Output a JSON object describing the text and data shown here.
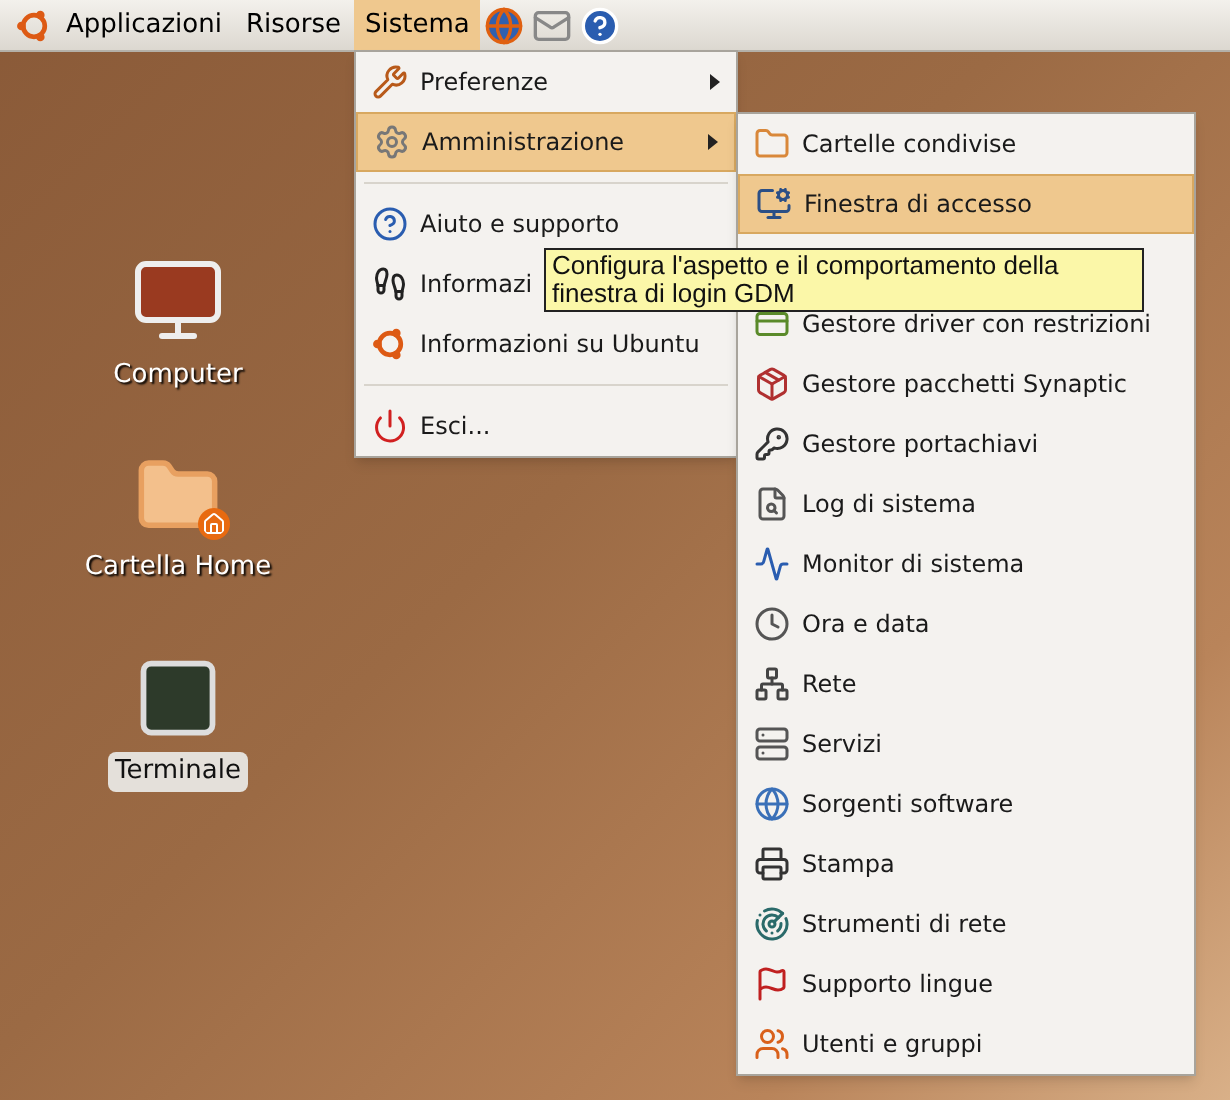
{
  "panel": {
    "menus": [
      {
        "label": "Applicazioni",
        "selected": false
      },
      {
        "label": "Risorse",
        "selected": false
      },
      {
        "label": "Sistema",
        "selected": true
      }
    ]
  },
  "desktop_icons": [
    {
      "kind": "computer",
      "label": "Computer",
      "selected": false
    },
    {
      "kind": "home",
      "label": "Cartella Home",
      "selected": false
    },
    {
      "kind": "terminal",
      "label": "Terminale",
      "selected": true
    }
  ],
  "system_menu": {
    "items": [
      {
        "kind": "item",
        "label": "Preferenze",
        "submenu": true,
        "selected": false
      },
      {
        "kind": "item",
        "label": "Amministrazione",
        "submenu": true,
        "selected": true
      },
      {
        "kind": "separator"
      },
      {
        "kind": "item",
        "label": "Aiuto e supporto",
        "submenu": false,
        "selected": false
      },
      {
        "kind": "item",
        "label": "Informazi",
        "submenu": false,
        "selected": false
      },
      {
        "kind": "item",
        "label": "Informazioni su Ubuntu",
        "submenu": false,
        "selected": false
      },
      {
        "kind": "separator"
      },
      {
        "kind": "item",
        "label": "Esci...",
        "submenu": false,
        "selected": false
      }
    ]
  },
  "admin_menu": {
    "items": [
      {
        "kind": "item",
        "label": "Cartelle condivise",
        "selected": false
      },
      {
        "kind": "item",
        "label": "Finestra di accesso",
        "selected": true
      },
      {
        "kind": "covered"
      },
      {
        "kind": "item",
        "label": "Gestore driver con restrizioni",
        "selected": false
      },
      {
        "kind": "item",
        "label": "Gestore pacchetti Synaptic",
        "selected": false
      },
      {
        "kind": "item",
        "label": "Gestore portachiavi",
        "selected": false
      },
      {
        "kind": "item",
        "label": "Log di sistema",
        "selected": false
      },
      {
        "kind": "item",
        "label": "Monitor di sistema",
        "selected": false
      },
      {
        "kind": "item",
        "label": "Ora e data",
        "selected": false
      },
      {
        "kind": "item",
        "label": "Rete",
        "selected": false
      },
      {
        "kind": "item",
        "label": "Servizi",
        "selected": false
      },
      {
        "kind": "item",
        "label": "Sorgenti software",
        "selected": false
      },
      {
        "kind": "item",
        "label": "Stampa",
        "selected": false
      },
      {
        "kind": "item",
        "label": "Strumenti di rete",
        "selected": false
      },
      {
        "kind": "item",
        "label": "Supporto lingue",
        "selected": false
      },
      {
        "kind": "item",
        "label": "Utenti e gruppi",
        "selected": false
      }
    ]
  },
  "tooltip": {
    "text": "Configura l'aspetto e il comportamento della finestra di login GDM"
  }
}
